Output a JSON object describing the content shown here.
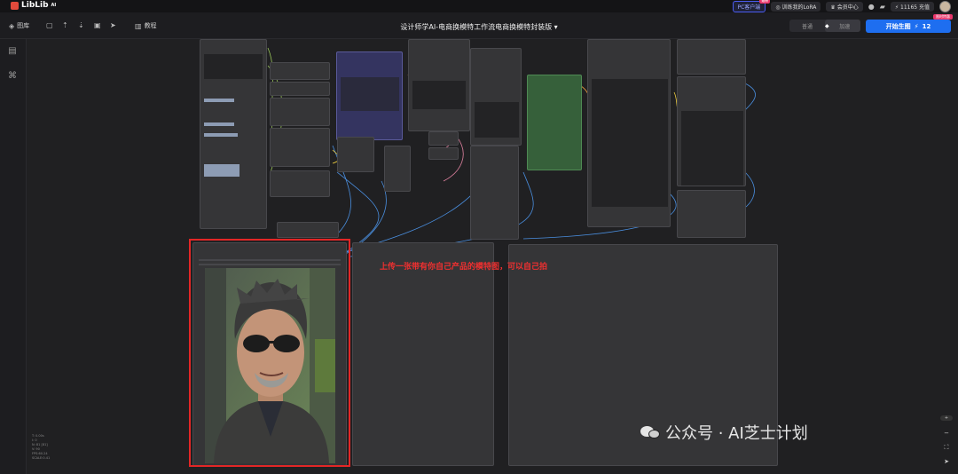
{
  "app": {
    "logo": "LibLib",
    "logo_sup": "AI"
  },
  "top_right": {
    "pc_client": "PC客户端",
    "pc_badge": "最新",
    "train_lora": "训练我的LoRA",
    "member": "会员中心",
    "credits": "11165 充值"
  },
  "toolbar": {
    "library": "图库",
    "tutorial": "教程",
    "workflow_title": "设计师学AI-电商换模特工作流电商换模特封装版",
    "mode_normal": "普通",
    "mode_fast": "加速",
    "generate": "开始生图",
    "generate_count": "12",
    "generate_tag": "限时特惠"
  },
  "annotation": {
    "text": "上传一张带有你自己产品的模特图，可以自己拍"
  },
  "stats": [
    "T: 0.00s",
    "I: 0",
    "N: 81 [81]",
    "V: 90",
    "FPS:60.24",
    "SCALE:0.41"
  ],
  "watermark": {
    "text": "公众号 · AI芝士计划"
  },
  "colors": {
    "accent": "#1e6ef0",
    "highlight": "#e32626",
    "note": "#ef3030"
  }
}
